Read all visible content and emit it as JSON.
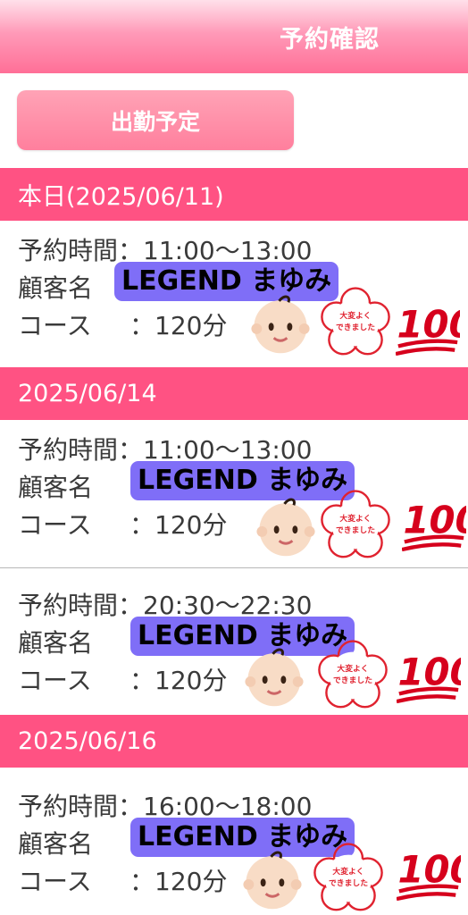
{
  "header": {
    "title": "予約確認"
  },
  "shift_button": {
    "label": "出勤予定"
  },
  "labels": {
    "time": "予約時間：",
    "customer": "顧客名",
    "course": "コース",
    "course_sep": "："
  },
  "days": [
    {
      "date": "本日(2025/06/11)",
      "reservations": [
        {
          "time": "11:00〜13:00",
          "customer": "LEGEND まゆみ",
          "course": "120分"
        }
      ]
    },
    {
      "date": "2025/06/14",
      "reservations": [
        {
          "time": "11:00〜13:00",
          "customer": "LEGEND まゆみ",
          "course": "120分"
        },
        {
          "time": "20:30〜22:30",
          "customer": "LEGEND まゆみ",
          "course": "120分"
        }
      ]
    },
    {
      "date": "2025/06/16",
      "reservations": [
        {
          "time": "16:00〜18:00",
          "customer": "LEGEND まゆみ",
          "course": "120分"
        }
      ]
    }
  ],
  "stickers": {
    "baby": "baby-face-icon",
    "stamp": "cherry-blossom-stamp-icon",
    "stamp_text": "大変よくできました。",
    "hundred": "hundred-points-icon"
  },
  "colors": {
    "accent": "#ff5283",
    "badge": "#7f6ef7",
    "stamp": "#e0222f",
    "hundred": "#d6001c"
  }
}
